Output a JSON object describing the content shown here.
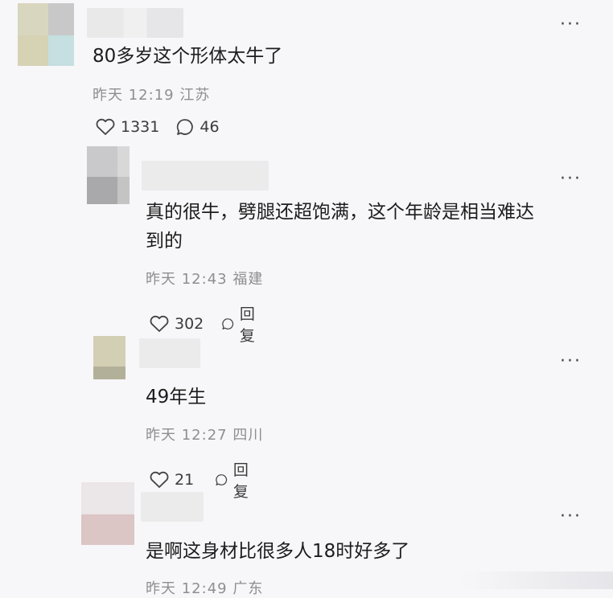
{
  "comments": [
    {
      "text": "80多岁这个形体太牛了",
      "time": "昨天 12:19",
      "location": "江苏",
      "likes": "1331",
      "replies": "46",
      "more": "···"
    },
    {
      "text_line1": "真的很牛，劈腿还超饱满，这个年龄是相当难达",
      "text_line2": "到的",
      "time": "昨天 12:43",
      "location": "福建",
      "likes": "302",
      "reply_label": "回复",
      "more": "···"
    },
    {
      "text": "49年生",
      "time": "昨天 12:27",
      "location": "四川",
      "likes": "21",
      "reply_label": "回复",
      "more": "···"
    },
    {
      "text": "是啊这身材比很多人18时好多了",
      "time": "昨天 12:49",
      "location": "广东",
      "more": "···"
    }
  ],
  "icons": {
    "like": "heart-outline-icon",
    "comment": "speech-bubble-icon"
  }
}
